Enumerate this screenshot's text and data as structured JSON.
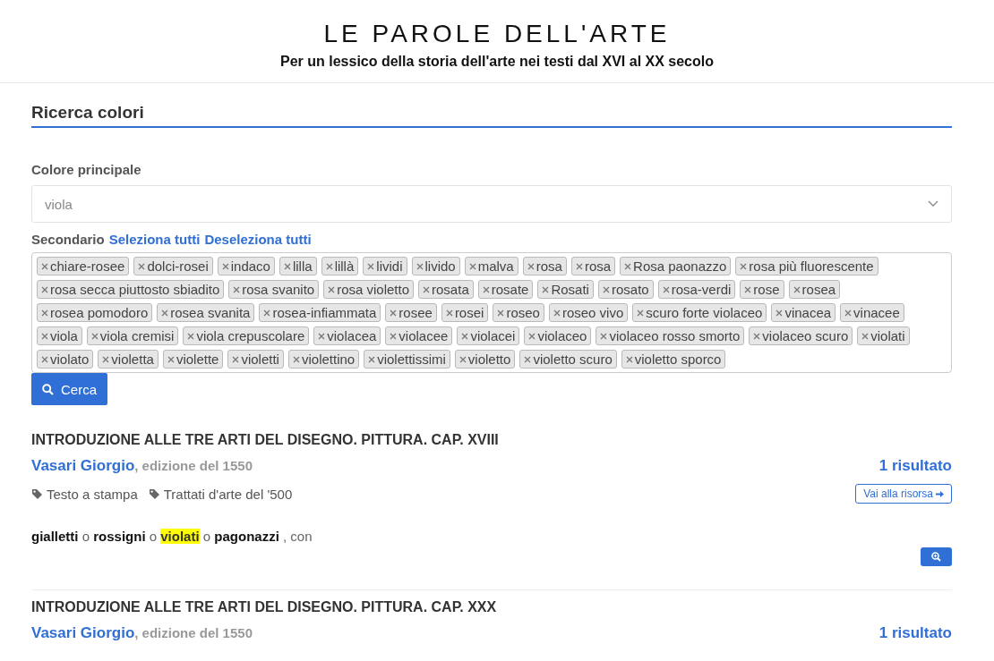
{
  "header": {
    "title": "LE PAROLE DELL'ARTE",
    "subtitle": "Per un lessico della storia dell'arte nei testi dal XVI al XX secolo"
  },
  "search": {
    "section_title": "Ricerca colori",
    "main_label": "Colore principale",
    "main_value": "viola",
    "secondary_label": "Secondario",
    "select_all": "Seleziona tutti",
    "deselect_all": "Deseleziona tutti",
    "tags": [
      "chiare-rosee",
      "dolci-rosei",
      "indaco",
      "lilla",
      "lillà",
      "lividi",
      "livido",
      "malva",
      "rosa",
      "rosa",
      "Rosa paonazzo",
      "rosa più fluorescente",
      "rosa secca piuttosto sbiadito",
      "rosa svanito",
      "rosa violetto",
      "rosata",
      "rosate",
      "Rosati",
      "rosato",
      "rosa-verdi",
      "rose",
      "rosea",
      "rosea pomodoro",
      "rosea svanita",
      "rosea-infiammata",
      "rosee",
      "rosei",
      "roseo",
      "roseo vivo",
      "scuro forte violaceo",
      "vinacea",
      "vinacee",
      "viola",
      "viola cremisi",
      "viola crepuscolare",
      "violacea",
      "violacee",
      "violacei",
      "violaceo",
      "violaceo rosso smorto",
      "violaceo scuro",
      "violati",
      "violato",
      "violetta",
      "violette",
      "violetti",
      "violettino",
      "violettissimi",
      "violetto",
      "violetto scuro",
      "violetto sporco"
    ],
    "button": "Cerca"
  },
  "results": [
    {
      "title": "INTRODUZIONE ALLE TRE ARTI DEL DISEGNO. PITTURA. CAP. XVIII",
      "author": "Vasari Giorgio",
      "edition": ", edizione del 1550",
      "count": "1 risultato",
      "labels": [
        "Testo a stampa",
        "Trattati d'arte del '500"
      ],
      "link": "Vai alla risorsa",
      "snippet": [
        {
          "text": "gialletti",
          "kind": "term"
        },
        {
          "text": "o",
          "kind": "plain"
        },
        {
          "text": "rossigni",
          "kind": "term"
        },
        {
          "text": "o",
          "kind": "plain"
        },
        {
          "text": "violati",
          "kind": "match"
        },
        {
          "text": "o",
          "kind": "plain"
        },
        {
          "text": "pagonazzi",
          "kind": "term"
        },
        {
          "text": ", con",
          "kind": "plain"
        }
      ]
    },
    {
      "title": "INTRODUZIONE ALLE TRE ARTI DEL DISEGNO. PITTURA. CAP. XXX",
      "author": "Vasari Giorgio",
      "edition": ", edizione del 1550",
      "count": "1 risultato"
    }
  ]
}
